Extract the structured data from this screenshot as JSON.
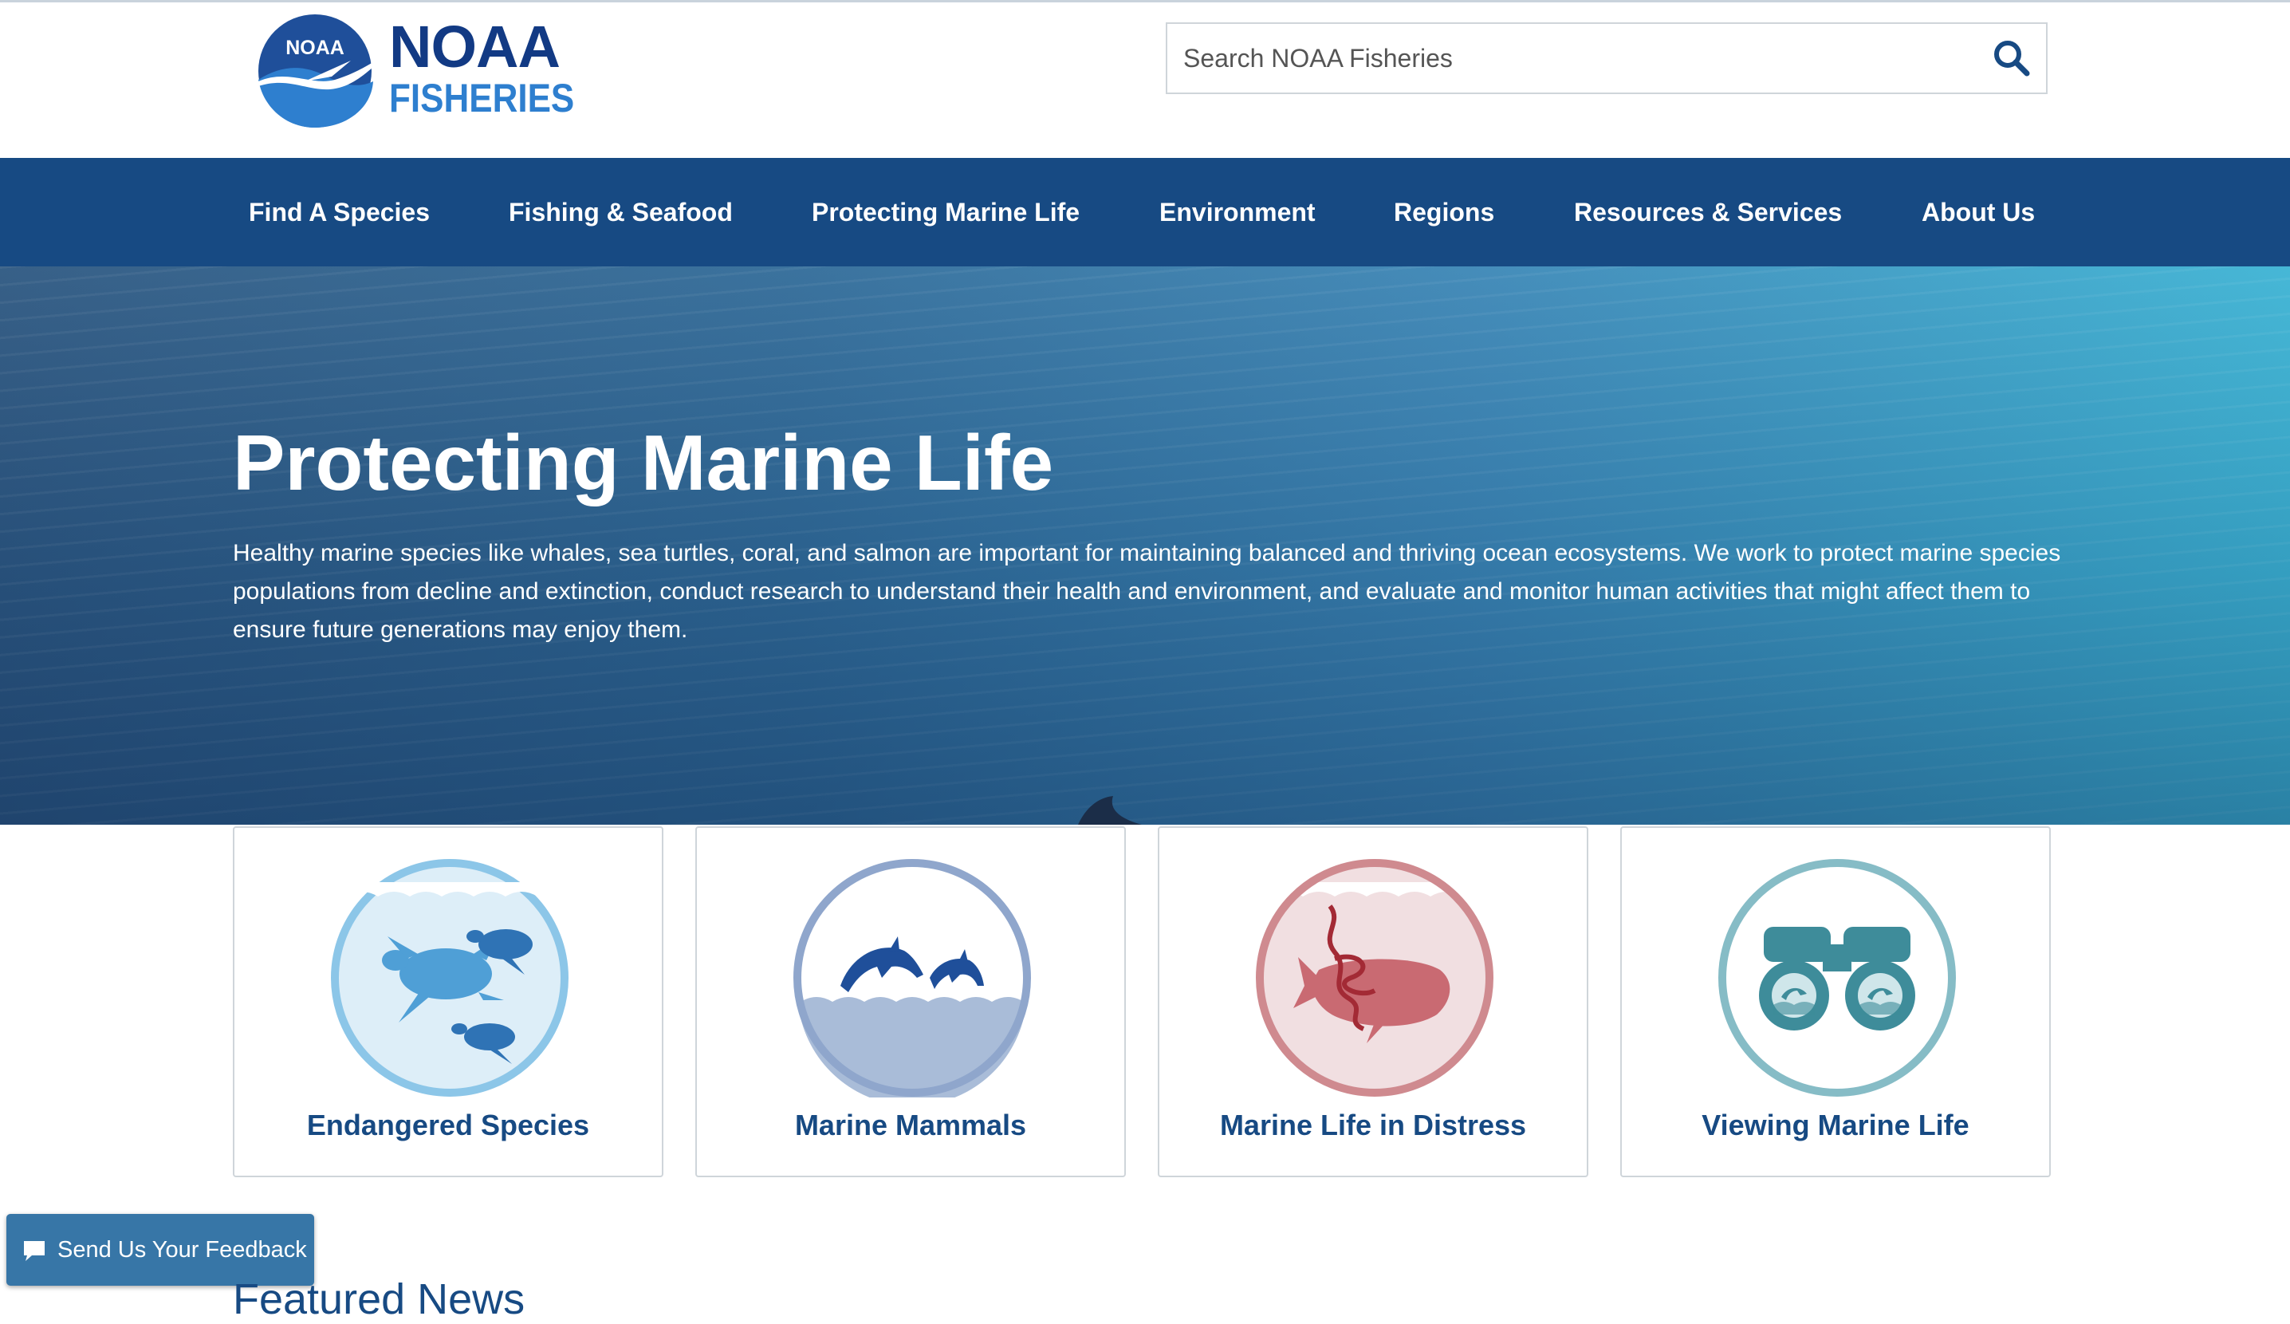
{
  "header": {
    "logo_emblem": "NOAA",
    "logo_title": "NOAA",
    "logo_subtitle": "FISHERIES",
    "search_placeholder": "Search NOAA Fisheries",
    "search_icon": "magnifier-icon"
  },
  "nav": {
    "items": [
      {
        "label": "Find A Species"
      },
      {
        "label": "Fishing & Seafood"
      },
      {
        "label": "Protecting Marine Life"
      },
      {
        "label": "Environment"
      },
      {
        "label": "Regions"
      },
      {
        "label": "Resources & Services"
      },
      {
        "label": "About Us"
      }
    ]
  },
  "hero": {
    "title": "Protecting Marine Life",
    "description": "Healthy marine species like whales, sea turtles, coral, and salmon are important for maintaining balanced and thriving ocean ecosystems. We work to protect marine species populations from decline and extinction, conduct research to understand their health and environment, and evaluate and monitor human activities that might affect them to ensure future generations may enjoy them."
  },
  "cards": [
    {
      "label": "Endangered Species",
      "icon": "sea-turtles-icon",
      "color": "#5da9d8"
    },
    {
      "label": "Marine Mammals",
      "icon": "dolphins-icon",
      "color": "#1f4f9a"
    },
    {
      "label": "Marine Life in Distress",
      "icon": "entangled-whale-icon",
      "color": "#b73a3a"
    },
    {
      "label": "Viewing Marine Life",
      "icon": "binoculars-icon",
      "color": "#3e8c9a"
    }
  ],
  "feedback": {
    "label": "Send Us Your Feedback",
    "icon": "chat-bubble-icon"
  },
  "featured": {
    "heading": "Featured News"
  },
  "colors": {
    "nav_bg": "#174a83",
    "link_blue": "#174a83",
    "feedback_bg": "#3776a7"
  }
}
